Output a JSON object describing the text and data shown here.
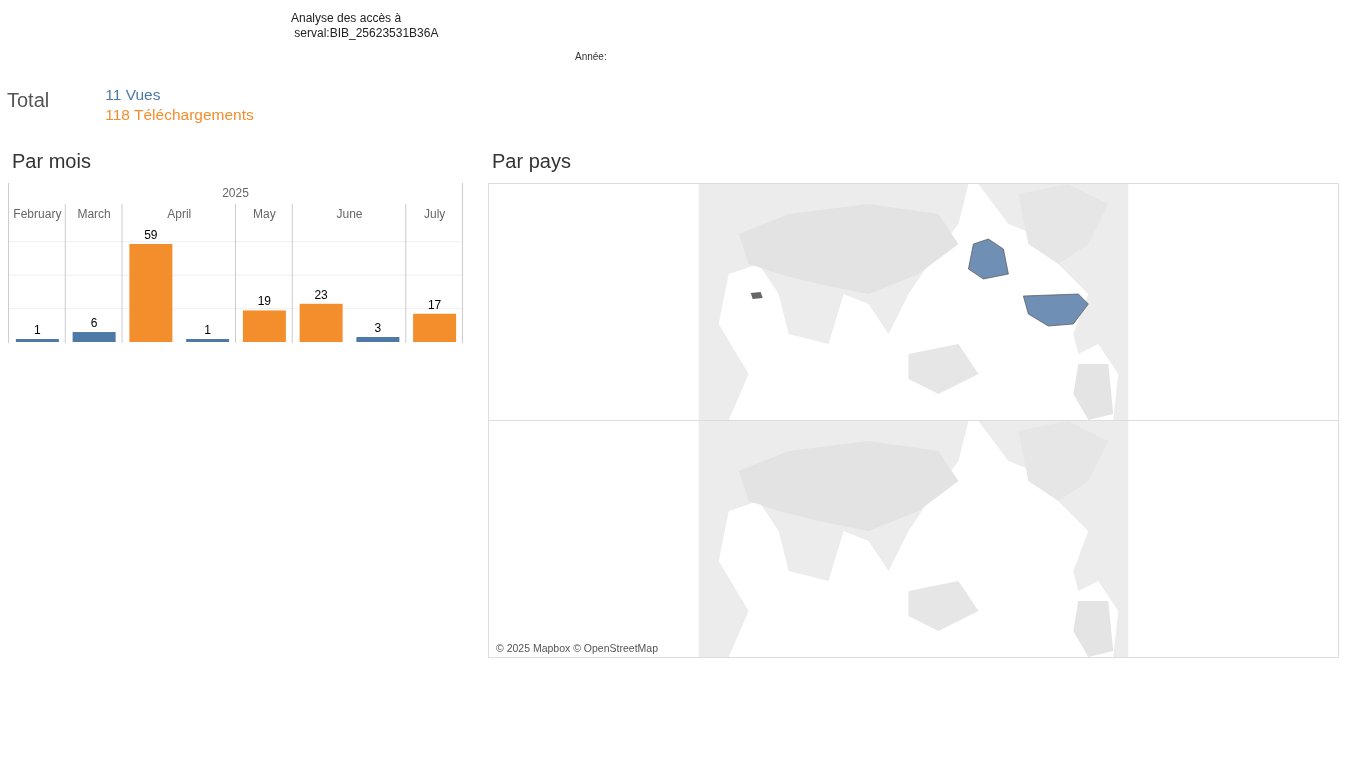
{
  "header": {
    "title": "Analyse des accès à",
    "subtitle": "serval:BIB_25623531B36A",
    "filter_label": "Année:"
  },
  "total": {
    "label": "Total",
    "views": "11 Vues",
    "downloads": "118 Téléchargements"
  },
  "by_month": {
    "title": "Par mois",
    "year_header": "2025",
    "chart_data": {
      "type": "bar",
      "categories": [
        "February",
        "March",
        "April",
        "May",
        "June",
        "July"
      ],
      "data_labels": true,
      "series": [
        {
          "color": "#f28e2b",
          "values": [
            null,
            null,
            59,
            19,
            23,
            17
          ]
        },
        {
          "color": "#4e79a7",
          "values": [
            1,
            6,
            1,
            null,
            3,
            null
          ]
        }
      ]
    }
  },
  "by_country": {
    "title": "Par pays",
    "attribution": "© 2025 Mapbox © OpenStreetMap"
  }
}
